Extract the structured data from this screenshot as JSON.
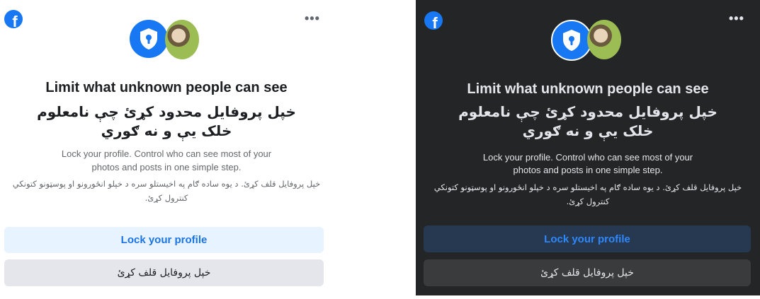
{
  "panels": [
    {
      "theme": "light",
      "title": "Limit what unknown people can see",
      "title_ps_line1": "خپل پروفایل محدود کړئ چې نامعلوم",
      "title_ps_line2": "خلک يې و نه ګوري",
      "description_line1": "Lock your profile. Control who can see most of your",
      "description_line2": "photos and posts in one simple step.",
      "description_ps_line1": "خپل پروفایل قلف کړئ. د يوه ساده ګام په اخيستلو سره د خپلو انځورونو او پوسټونو کتونکي",
      "description_ps_line2": "کنترول کړئ.",
      "primary_button": "Lock your profile",
      "secondary_button": "خپل پروفایل قلف کړئ"
    },
    {
      "theme": "dark",
      "title": "Limit what unknown people can see",
      "title_ps_line1": "خپل پروفایل محدود کړئ چې نامعلوم",
      "title_ps_line2": "خلک يې و نه ګوري",
      "description_line1": "Lock your profile. Control who can see most of your",
      "description_line2": "photos and posts in one simple step.",
      "description_ps_line1": "خپل پروفایل قلف کړئ. د يوه ساده ګام په اخيستلو سره د خپلو انځورونو او پوسټونو کتونکي",
      "description_ps_line2": "کنترول کړئ.",
      "primary_button": "Lock your profile",
      "secondary_button": "خپل پروفایل قلف کړئ"
    }
  ],
  "logo_letter": "f",
  "more_label": "•••",
  "colors": {
    "brand_blue": "#1877f2",
    "light_primary_bg": "#e7f3ff",
    "dark_bg": "#242527",
    "dark_primary_bg": "#263951"
  },
  "icons": [
    "facebook-logo-icon",
    "more-options-icon",
    "shield-lock-icon",
    "profile-avatar"
  ]
}
